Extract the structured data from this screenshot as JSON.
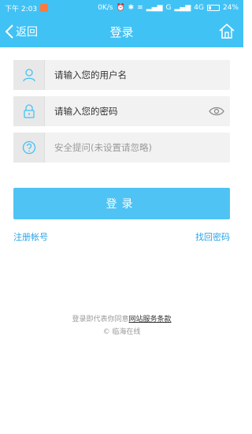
{
  "status_bar": {
    "time": "下午 2:03",
    "network_speed": "0K/s",
    "signal_label": "G",
    "network_type": "4G",
    "battery": "24%"
  },
  "nav": {
    "back_label": "返回",
    "title": "登录"
  },
  "form": {
    "username_placeholder": "请输入您的用户名",
    "password_placeholder": "请输入您的密码",
    "security_placeholder": "安全提问(未设置请忽略)"
  },
  "actions": {
    "login_label": "登录",
    "register_label": "注册帐号",
    "forgot_label": "找回密码"
  },
  "footer": {
    "agree_text": "登录即代表你同意",
    "terms_link": "网站服务条款",
    "copyright": "© 临海在线"
  },
  "colors": {
    "accent": "#41c2f5",
    "link": "#2aa5e8"
  }
}
